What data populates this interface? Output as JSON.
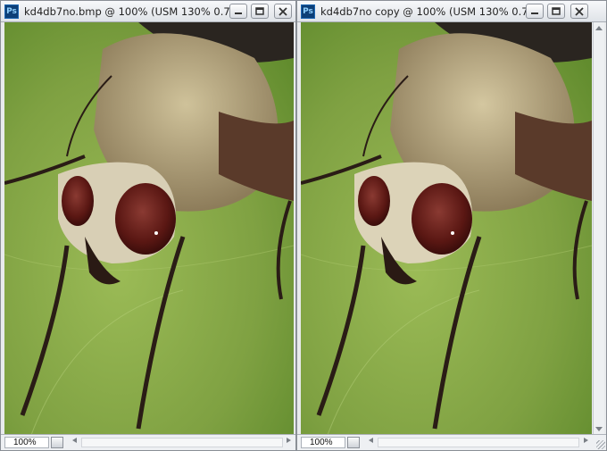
{
  "windows": [
    {
      "title": "kd4db7no.bmp @ 100% (USM 130% 0.7 ...",
      "zoom": "100%"
    },
    {
      "title": "kd4db7no copy @ 100% (USM 130% 0.7 ...",
      "zoom": "100%"
    }
  ],
  "app_icon": "Ps",
  "icons": {
    "minimize": "minimize-icon",
    "restore": "restore-icon",
    "close": "close-icon"
  },
  "colors": {
    "leaf_green": "#7fa142",
    "fly_eye": "#6b1e1a",
    "title_bg": "#e6e9ed"
  }
}
